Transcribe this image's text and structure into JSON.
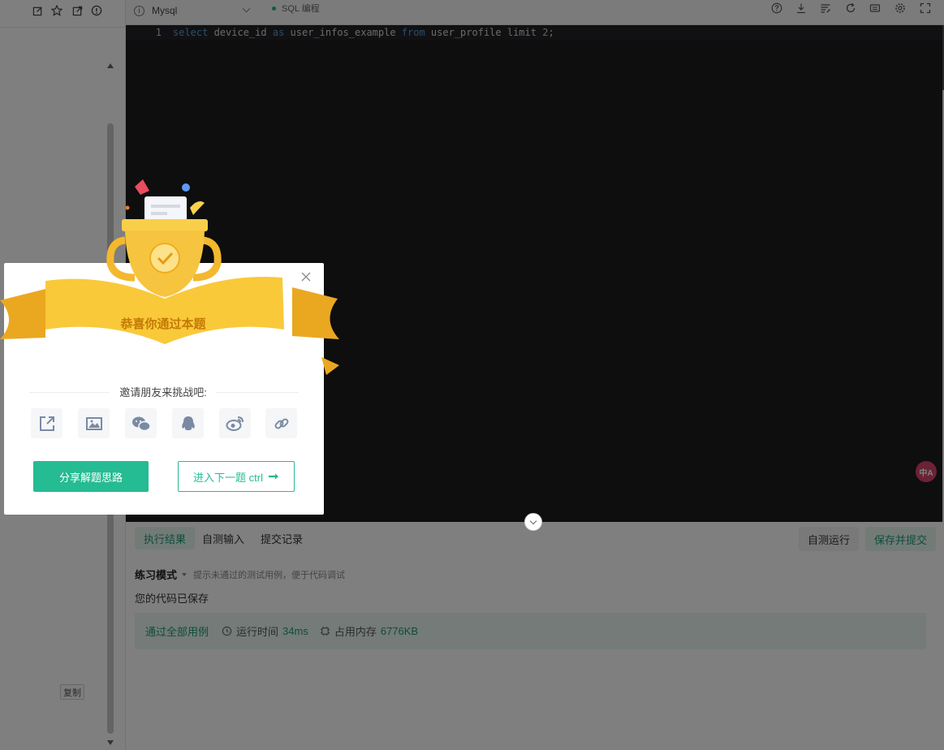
{
  "editor": {
    "language": "Mysql",
    "mode_label": "SQL 编程",
    "line_number": "1",
    "code_tokens": [
      {
        "t": "select",
        "k": "kw"
      },
      {
        "t": " device_id ",
        "k": "tx"
      },
      {
        "t": "as",
        "k": "kw"
      },
      {
        "t": " user_infos_example ",
        "k": "tx"
      },
      {
        "t": "from",
        "k": "kw"
      },
      {
        "t": " user_profile ",
        "k": "tx"
      },
      {
        "t": "limit",
        "k": "tx"
      },
      {
        "t": " 2",
        "k": "nm"
      },
      {
        "t": ";",
        "k": "tx"
      }
    ],
    "translate_badge": "中A"
  },
  "left_panel": {
    "copy_label": "复制"
  },
  "result_panel": {
    "tabs": {
      "results": "执行结果",
      "custom_input": "自测输入",
      "submissions": "提交记录"
    },
    "self_test_label": "自测运行",
    "save_submit_label": "保存并提交",
    "practice_mode": "练习模式",
    "practice_hint": "提示未通过的测试用例，便于代码调试",
    "saved_text": "您的代码已保存",
    "pass_label": "通过全部用例",
    "runtime_label": "运行时间",
    "runtime_value": "34ms",
    "memory_label": "占用内存",
    "memory_value": "6776KB"
  },
  "modal": {
    "congrats": "恭喜你通过本题",
    "invite": "邀请朋友来挑战吧:",
    "share_solution_label": "分享解题思路",
    "next_question_label": "进入下一题 ctrl"
  },
  "colors": {
    "accent": "#25bb93",
    "trophy_gold": "#f7c440",
    "ribbon": "#f9c93a"
  }
}
